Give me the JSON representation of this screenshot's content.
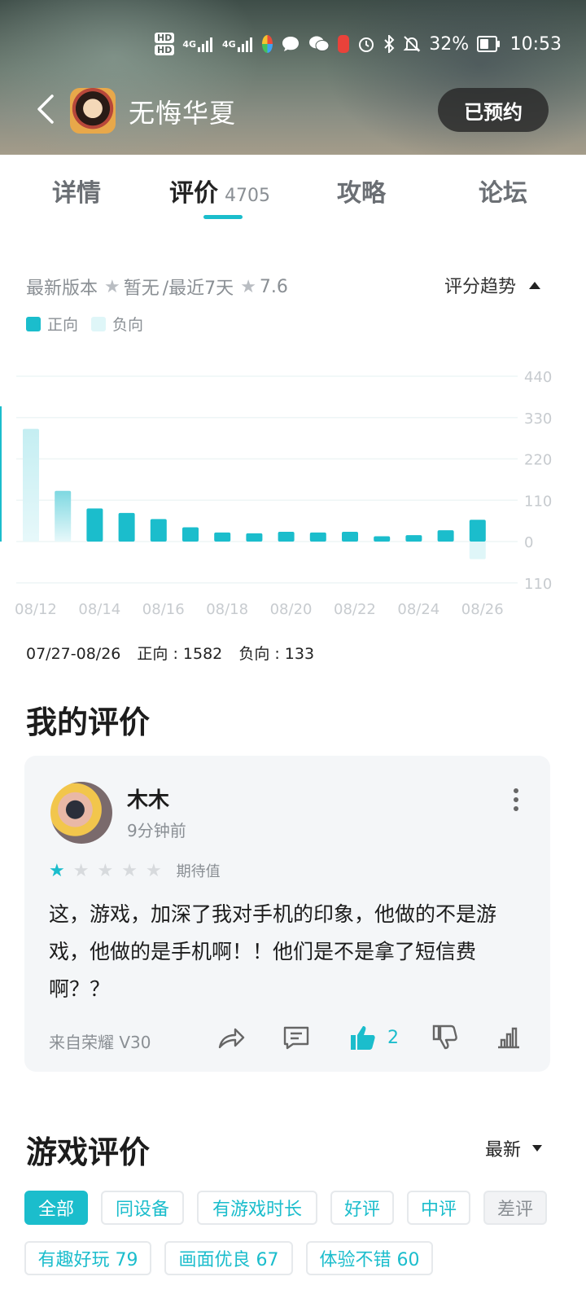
{
  "status_bar": {
    "battery": "32%",
    "time": "10:53",
    "network": [
      "4G",
      "4G"
    ],
    "hd_badges": [
      "HD",
      "HD"
    ]
  },
  "header": {
    "title": "无悔华夏",
    "reserve_label": "已预约"
  },
  "tabs": [
    {
      "label": "详情"
    },
    {
      "label": "评价",
      "count": "4705"
    },
    {
      "label": "攻略"
    },
    {
      "label": "论坛"
    }
  ],
  "rating": {
    "latest_label": "最新版本",
    "latest_value": "暂无",
    "recent_label": "/最近7天",
    "recent_value": "7.6",
    "trend_label": "评分趋势"
  },
  "legend": {
    "positive": "正向",
    "negative": "负向"
  },
  "colors": {
    "accent": "#1bbdcc",
    "negative_bar": "#dff6f8",
    "text_secondary": "#8a8f94"
  },
  "chart_data": {
    "type": "bar",
    "categories": [
      "08/12",
      "08/13",
      "08/14",
      "08/15",
      "08/16",
      "08/17",
      "08/18",
      "08/19",
      "08/20",
      "08/21",
      "08/22",
      "08/23",
      "08/24",
      "08/25",
      "08/26"
    ],
    "x_tick_labels": [
      "08/12",
      "08/14",
      "08/16",
      "08/18",
      "08/20",
      "08/22",
      "08/24",
      "08/26"
    ],
    "y_tick_labels": [
      "440",
      "330",
      "220",
      "110",
      "0",
      "110"
    ],
    "ylim": [
      -110,
      440
    ],
    "series": [
      {
        "name": "正向",
        "values": [
          300,
          135,
          88,
          76,
          60,
          38,
          24,
          22,
          26,
          24,
          26,
          14,
          17,
          30,
          58
        ]
      },
      {
        "name": "负向",
        "values": [
          0,
          0,
          0,
          0,
          0,
          0,
          0,
          0,
          0,
          0,
          0,
          0,
          0,
          0,
          -100
        ]
      }
    ],
    "faded_positive_indexes": [
      0,
      1
    ]
  },
  "summary": {
    "range": "07/27-08/26",
    "positive": "正向 : 1582",
    "negative": "负向 : 133"
  },
  "my_review": {
    "section_title": "我的评价",
    "user": "木木",
    "time": "9分钟前",
    "rating": 1,
    "rating_label": "期待值",
    "text": "这，游戏，加深了我对手机的印象，他做的不是游戏，他做的是手机啊！！他们是不是拿了短信费啊？？",
    "device": "来自荣耀 V30",
    "likes": "2"
  },
  "game_reviews": {
    "section_title": "游戏评价",
    "sort_label": "最新",
    "filters": [
      "全部",
      "同设备",
      "有游戏时长",
      "好评",
      "中评",
      "差评"
    ],
    "tags": [
      "有趣好玩 79",
      "画面优良 67",
      "体验不错 60"
    ]
  }
}
